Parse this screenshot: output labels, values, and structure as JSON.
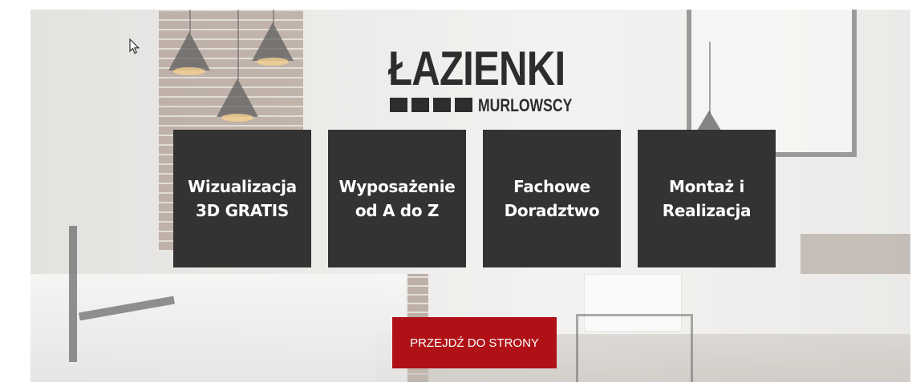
{
  "logo": {
    "main_text": "ŁAZIENKI",
    "sub_text": "MURLOWSCY"
  },
  "tiles": [
    {
      "line1": "Wizualizacja",
      "line2": "3D GRATIS"
    },
    {
      "line1": "Wyposażenie",
      "line2": "od A do Z"
    },
    {
      "line1": "Fachowe",
      "line2": "Doradztwo"
    },
    {
      "line1": "Montaż i",
      "line2": "Realizacja"
    }
  ],
  "cta": {
    "label": "PRZEJDŹ DO STRONY"
  },
  "colors": {
    "tile_background": "#333333",
    "cta_background": "#b01117",
    "logo": "#2d2d2d"
  },
  "icons": {
    "cursor": "mouse-pointer-icon"
  }
}
